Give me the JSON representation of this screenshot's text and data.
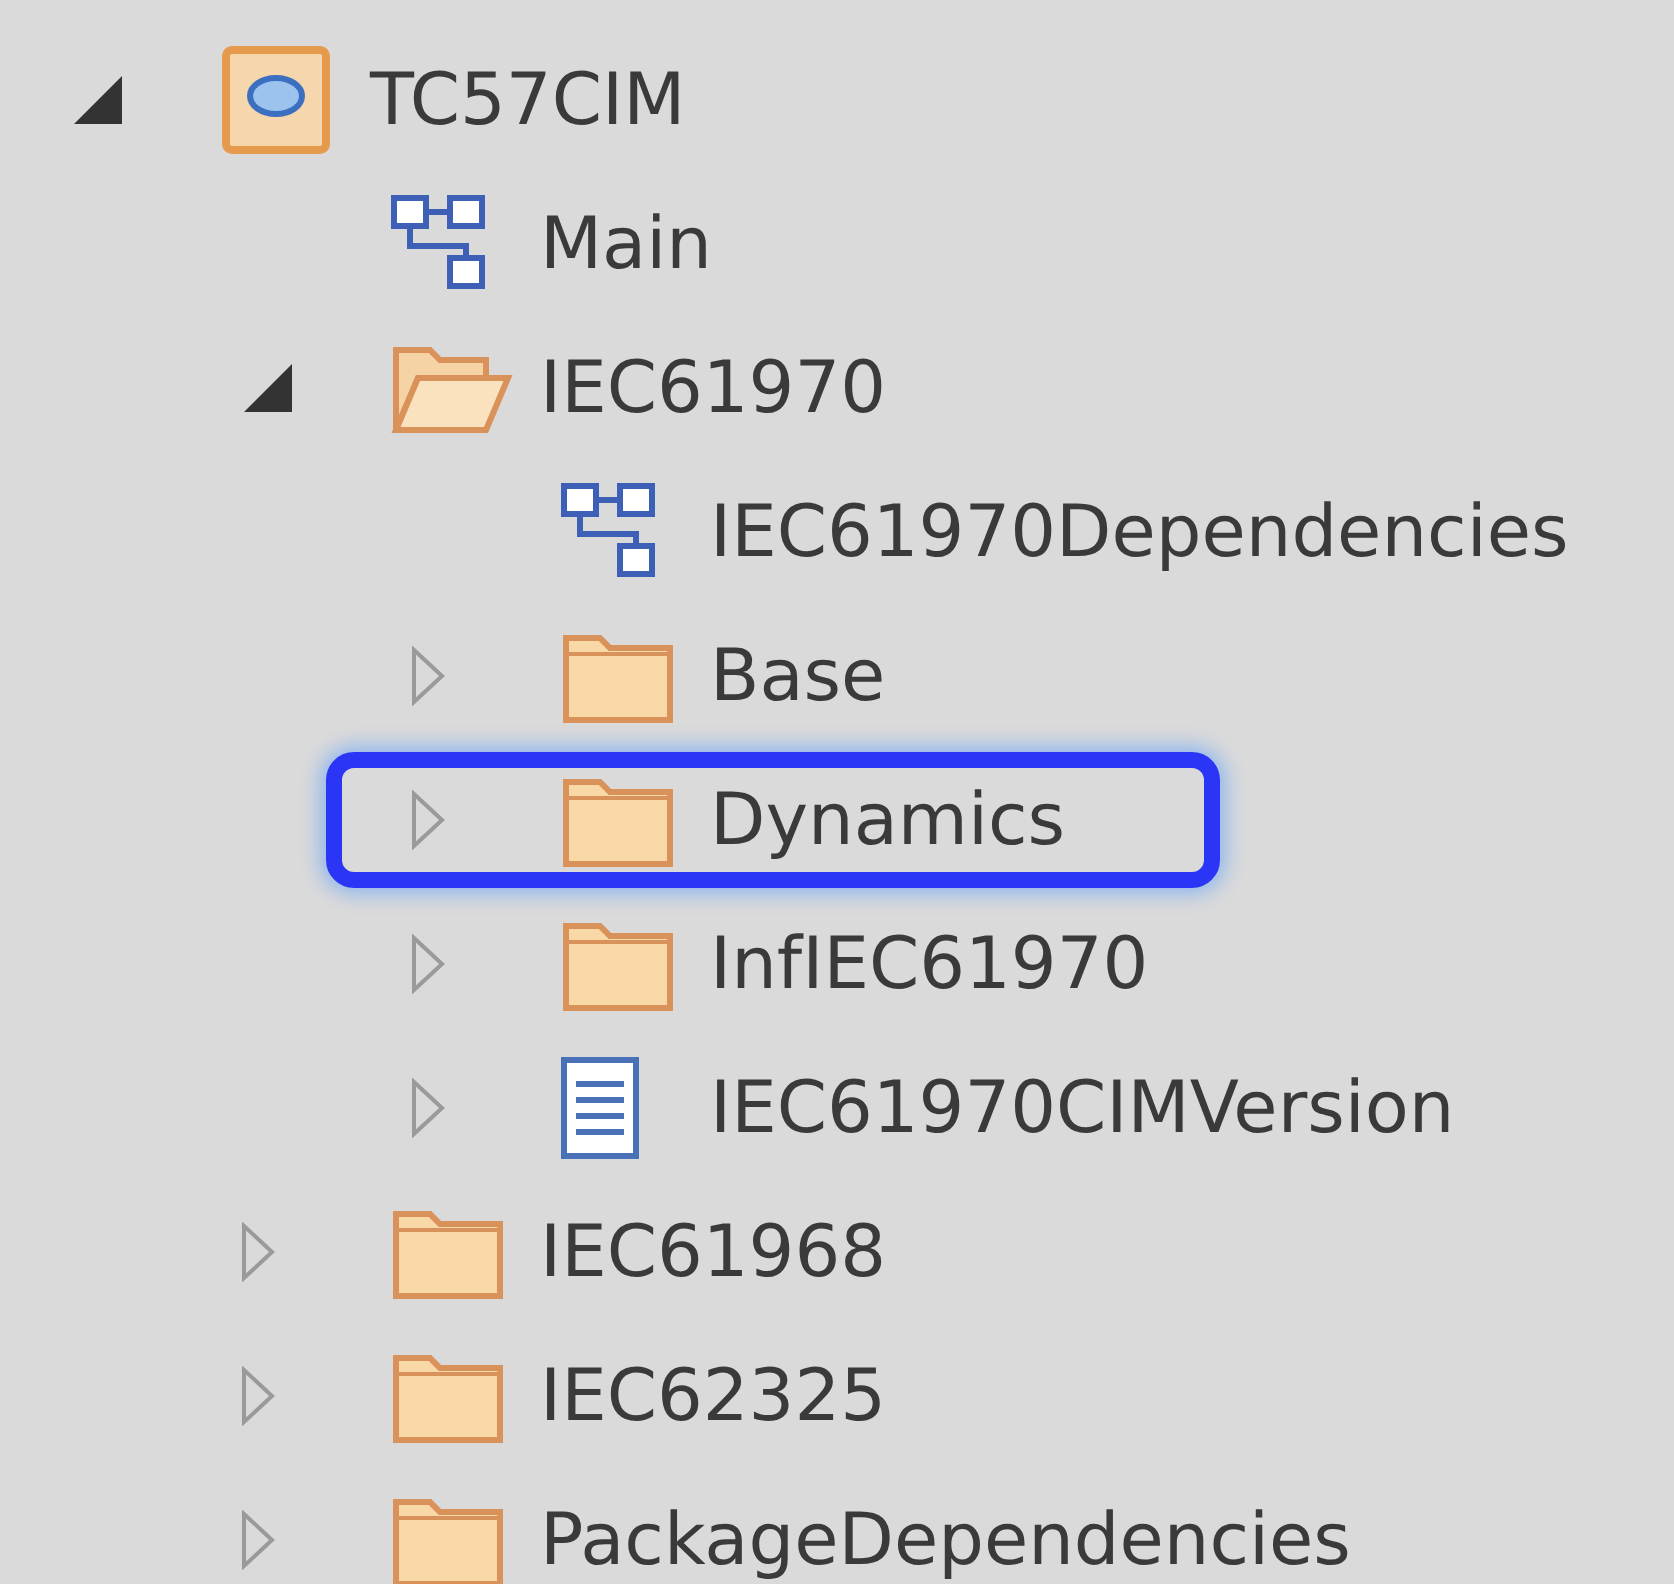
{
  "tree": [
    {
      "label": "TC57CIM",
      "kind": "model",
      "expanded": true,
      "highlighted": false,
      "children": [
        {
          "label": "Main",
          "kind": "diagram",
          "highlighted": false
        },
        {
          "label": "IEC61970",
          "kind": "folder",
          "expanded": true,
          "highlighted": false,
          "children": [
            {
              "label": "IEC61970Dependencies",
              "kind": "diagram",
              "highlighted": false
            },
            {
              "label": "Base",
              "kind": "folder",
              "expanded": false,
              "highlighted": false
            },
            {
              "label": "Dynamics",
              "kind": "folder",
              "expanded": false,
              "highlighted": true
            },
            {
              "label": "InfIEC61970",
              "kind": "folder",
              "expanded": false,
              "highlighted": false
            },
            {
              "label": "IEC61970CIMVersion",
              "kind": "class",
              "expanded": false,
              "highlighted": false
            }
          ]
        },
        {
          "label": "IEC61968",
          "kind": "folder",
          "expanded": false,
          "highlighted": false
        },
        {
          "label": "IEC62325",
          "kind": "folder",
          "expanded": false,
          "highlighted": false
        },
        {
          "label": "PackageDependencies",
          "kind": "folder",
          "expanded": false,
          "highlighted": false
        }
      ]
    }
  ]
}
